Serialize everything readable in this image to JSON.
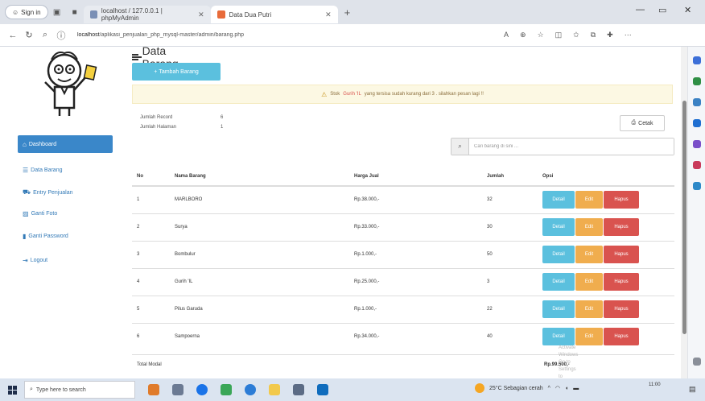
{
  "browser": {
    "profile_label": "Sign in",
    "tabs": [
      {
        "title": "localhost / 127.0.0.1 | phpMyAdmin"
      },
      {
        "title": "Data Dua Putri"
      }
    ],
    "url_host": "localhost",
    "url_path": "/aplikasi_penjualan_php_mysql-master/admin/barang.php"
  },
  "sidebar": {
    "items": [
      {
        "label": "Dashboard",
        "icon": "home-icon"
      },
      {
        "label": "Data Barang",
        "icon": "list-icon"
      },
      {
        "label": "Entry Penjualan",
        "icon": "cart-icon"
      },
      {
        "label": "Ganti Foto",
        "icon": "picture-icon"
      },
      {
        "label": "Ganti Password",
        "icon": "lock-icon"
      },
      {
        "label": "Logout",
        "icon": "logout-icon"
      }
    ]
  },
  "page": {
    "title": "Data Barang",
    "add_button": "Tambah Barang",
    "alert_prefix": "Stok",
    "alert_item": "Gurih 'IL",
    "alert_suffix": "yang tersisa sudah kurang dari 3 . silahkan pesan lagi !!",
    "jumlah_record_label": "Jumlah Record",
    "jumlah_record_value": "6",
    "jumlah_halaman_label": "Jumlah Halaman",
    "jumlah_halaman_value": "1",
    "print_button": "Cetak",
    "search_placeholder": "Cari barang di sini ..."
  },
  "table": {
    "headers": [
      "No",
      "Nama Barang",
      "Harga Jual",
      "Jumlah",
      "Opsi"
    ],
    "actions": {
      "detail": "Detail",
      "edit": "Edit",
      "hapus": "Hapus"
    },
    "rows": [
      {
        "no": "1",
        "nama": "MARLBORO",
        "harga": "Rp.38.000,-",
        "jumlah": "32"
      },
      {
        "no": "2",
        "nama": "Surya",
        "harga": "Rp.33.000,-",
        "jumlah": "30"
      },
      {
        "no": "3",
        "nama": "Bombulur",
        "harga": "Rp.1.000,-",
        "jumlah": "50"
      },
      {
        "no": "4",
        "nama": "Gurih 'IL",
        "harga": "Rp.25.000,-",
        "jumlah": "3"
      },
      {
        "no": "5",
        "nama": "Pilus Garuda",
        "harga": "Rp.1.000,-",
        "jumlah": "22"
      },
      {
        "no": "6",
        "nama": "Sampoerna",
        "harga": "Rp.34.000,-",
        "jumlah": "40"
      }
    ],
    "total_label": "Total Modal",
    "total_value": "Rp.99.500,-"
  },
  "watermark": {
    "line1": "Activate Windows",
    "line2": "Go to Settings to activate Windows."
  },
  "taskbar": {
    "search_placeholder": "Type here to search",
    "weather": "25°C Sebagian cerah",
    "time": "11:00"
  },
  "colors": {
    "info": "#5bc0de",
    "warning": "#f0ad4e",
    "danger": "#d9534f",
    "primary": "#3a87c9"
  }
}
